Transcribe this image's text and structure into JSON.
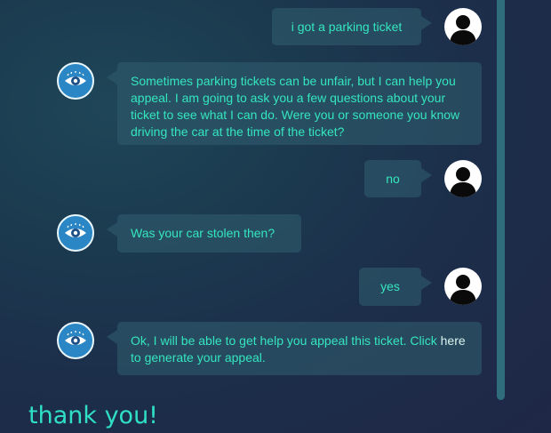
{
  "messages": [
    {
      "from": "user",
      "text": "i got a parking ticket"
    },
    {
      "from": "bot",
      "text": "Sometimes parking tickets can be unfair, but I can help you appeal. I am going to ask you a few questions about your ticket to see what I can do. Were you or someone you know driving the car at the time of the ticket?"
    },
    {
      "from": "user",
      "text": "no"
    },
    {
      "from": "bot",
      "text": "Was your car stolen then?"
    },
    {
      "from": "user",
      "text": "yes"
    },
    {
      "from": "bot",
      "text_before": "Ok, I will be able to get help you appeal this ticket. Click",
      "link": "here",
      "text_after": "to generate your appeal."
    }
  ],
  "footer": {
    "caption": "thank you!"
  },
  "colors": {
    "bubble_text": "#34e6be",
    "bubble_bg": "#2e5a6c",
    "link_text": "#d8f4ee",
    "bot_avatar_bg": "#2a86c4",
    "user_avatar_bg": "#ffffff",
    "scrollbar": "#2f6c7c"
  },
  "icons": {
    "user_avatar": "person-silhouette-icon",
    "bot_avatar": "eye-icon"
  }
}
